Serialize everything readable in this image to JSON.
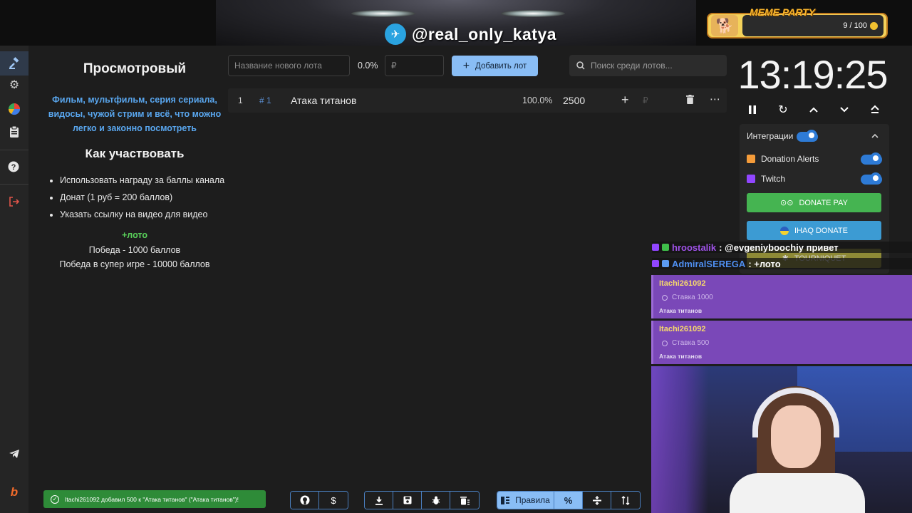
{
  "overlay": {
    "telegram_handle": "@real_only_katya",
    "meme_party": {
      "title": "MEME PARTY",
      "count": "9 / 100"
    }
  },
  "sidebar": {
    "items": [
      "auction-icon",
      "settings-icon",
      "stats-icon",
      "clipboard-icon",
      "help-icon",
      "logout-icon",
      "telegram-icon",
      "boosty-icon"
    ]
  },
  "description": {
    "title": "Просмотровый",
    "subtitle": "Фильм, мультфильм, серия сериала, видосы, чужой стрим и всё, что можно легко и законно посмотреть",
    "how_title": "Как участвовать",
    "bullets": [
      "Использовать награду за баллы канала",
      "Донат (1 руб = 200 баллов)",
      "Указать ссылку на видео для видео"
    ],
    "loto": "+лото",
    "win_line": "Победа - 1000 баллов",
    "super_line": "Победа в супер игре - 10000 баллов"
  },
  "lot_form": {
    "name_placeholder": "Название нового лота",
    "percent": "0.0%",
    "amount_placeholder": "₽",
    "add_button": "Добавить лот",
    "search_placeholder": "Поиск среди лотов..."
  },
  "lots": [
    {
      "index": "1",
      "id": "# 1",
      "name": "Атака титанов",
      "percent": "100.0%",
      "amount": "2500",
      "currency": "₽"
    }
  ],
  "timer": {
    "value": "13:19:25"
  },
  "integrations": {
    "title": "Интеграции",
    "items": [
      {
        "label": "Donation Alerts",
        "icon_color": "#f59c3a",
        "enabled": true
      },
      {
        "label": "Twitch",
        "icon_color": "#9146ff",
        "enabled": true
      }
    ],
    "buttons": [
      {
        "label": "DONATE PAY",
        "color": "#45b451"
      },
      {
        "label": "IHAQ DONATE",
        "color": "#3c9bd3"
      },
      {
        "label": "TOURNIQUET",
        "color": "#a8a33a"
      }
    ]
  },
  "chat": [
    {
      "user": "hroostalik",
      "user_color": "#9f52e8",
      "message": ": @evgeniyboochiy привет"
    },
    {
      "user": "AdmiralSEREGA",
      "user_color": "#4f8ff0",
      "message": ": +лото"
    }
  ],
  "notices": [
    {
      "user": "Itachi261092",
      "bet": "Ставка 1000",
      "lot": "Атака титанов"
    },
    {
      "user": "Itachi261092",
      "bet": "Ставка 500",
      "lot": "Атака титанов"
    }
  ],
  "toast": {
    "text": "Itachi261092 добавил 500 к \"Атака титанов\" (\"Атака титанов\")!"
  },
  "bottom_bar": {
    "rules_label": "Правила"
  },
  "colors": {
    "accent": "#89bdf5",
    "background": "#1d1d1d",
    "toast": "#2e8b38",
    "notice": "#7a48b8"
  }
}
